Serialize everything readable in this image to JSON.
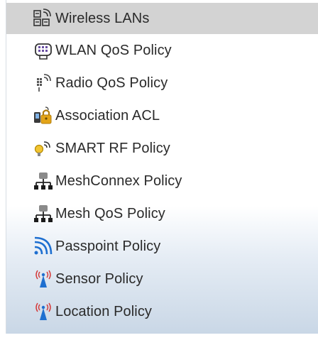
{
  "menu": {
    "items": [
      {
        "label": "Wireless LANs",
        "icon": "wireless-lan-icon",
        "selected": true
      },
      {
        "label": "WLAN QoS Policy",
        "icon": "wlan-qos-icon"
      },
      {
        "label": "Radio QoS Policy",
        "icon": "radio-qos-icon"
      },
      {
        "label": "Association ACL",
        "icon": "association-acl-icon"
      },
      {
        "label": "SMART RF Policy",
        "icon": "smart-rf-icon"
      },
      {
        "label": "MeshConnex Policy",
        "icon": "meshconnex-icon"
      },
      {
        "label": "Mesh QoS Policy",
        "icon": "mesh-qos-icon"
      },
      {
        "label": "Passpoint Policy",
        "icon": "passpoint-icon"
      },
      {
        "label": "Sensor Policy",
        "icon": "sensor-icon"
      },
      {
        "label": "Location Policy",
        "icon": "location-icon"
      }
    ]
  },
  "colors": {
    "selected_bg": "#d3d3d3",
    "text": "#2a2a2a",
    "accent_blue": "#1e6fd0",
    "lock_gold": "#e3a417"
  }
}
